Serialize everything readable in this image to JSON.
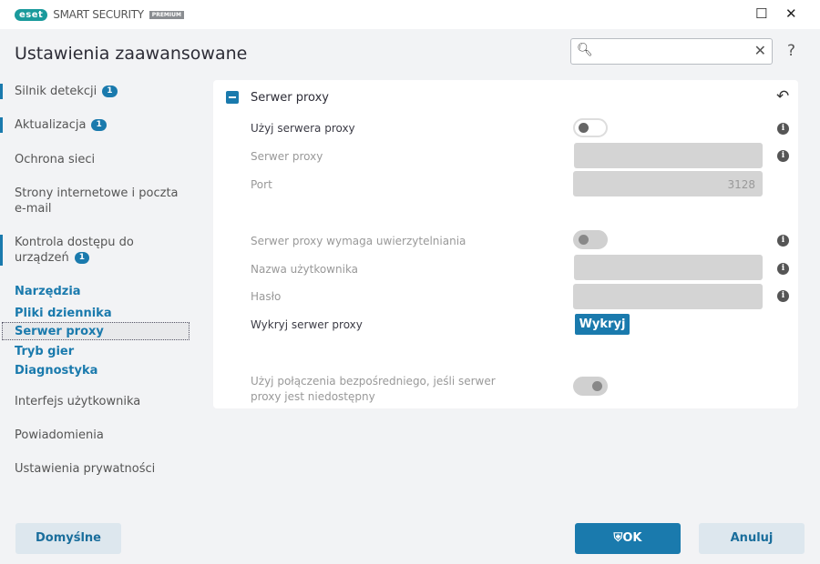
{
  "app": {
    "logo": "eset",
    "product": "SMART SECURITY",
    "edition": "PREMIUM",
    "minimize": "☐",
    "close": "✕"
  },
  "header": {
    "title": "Ustawienia zaawansowane",
    "search_placeholder": "",
    "help": "?"
  },
  "sidebar": {
    "items": [
      {
        "label": "Silnik detekcji",
        "badge": "1"
      },
      {
        "label": "Aktualizacja",
        "badge": "1"
      },
      {
        "label": "Ochrona sieci"
      },
      {
        "label": "Strony internetowe i poczta e-mail"
      },
      {
        "label": "Kontrola dostępu do urządzeń",
        "badge": "1"
      },
      {
        "label": "Narzędzia"
      },
      {
        "label": "Pliki dziennika"
      },
      {
        "label": "Serwer proxy"
      },
      {
        "label": "Tryb gier"
      },
      {
        "label": "Diagnostyka"
      },
      {
        "label": "Interfejs użytkownika"
      },
      {
        "label": "Powiadomienia"
      },
      {
        "label": "Ustawienia prywatności"
      }
    ]
  },
  "panel": {
    "title": "Serwer proxy",
    "use_proxy": {
      "label": "Użyj serwera proxy",
      "value": false
    },
    "proxy_server": {
      "label": "Serwer proxy",
      "value": ""
    },
    "port": {
      "label": "Port",
      "value": "3128"
    },
    "auth_required": {
      "label": "Serwer proxy wymaga uwierzytelniania",
      "value": false
    },
    "username": {
      "label": "Nazwa użytkownika",
      "value": ""
    },
    "password": {
      "label": "Hasło",
      "value": ""
    },
    "detect": {
      "label": "Wykryj serwer proxy",
      "button": "Wykryj"
    },
    "direct": {
      "label": "Użyj połączenia bezpośredniego, jeśli serwer proxy jest niedostępny",
      "value": true
    }
  },
  "footer": {
    "default": "Domyślne",
    "ok": "OK",
    "cancel": "Anuluj"
  },
  "colors": {
    "accent": "#1a7aad"
  }
}
